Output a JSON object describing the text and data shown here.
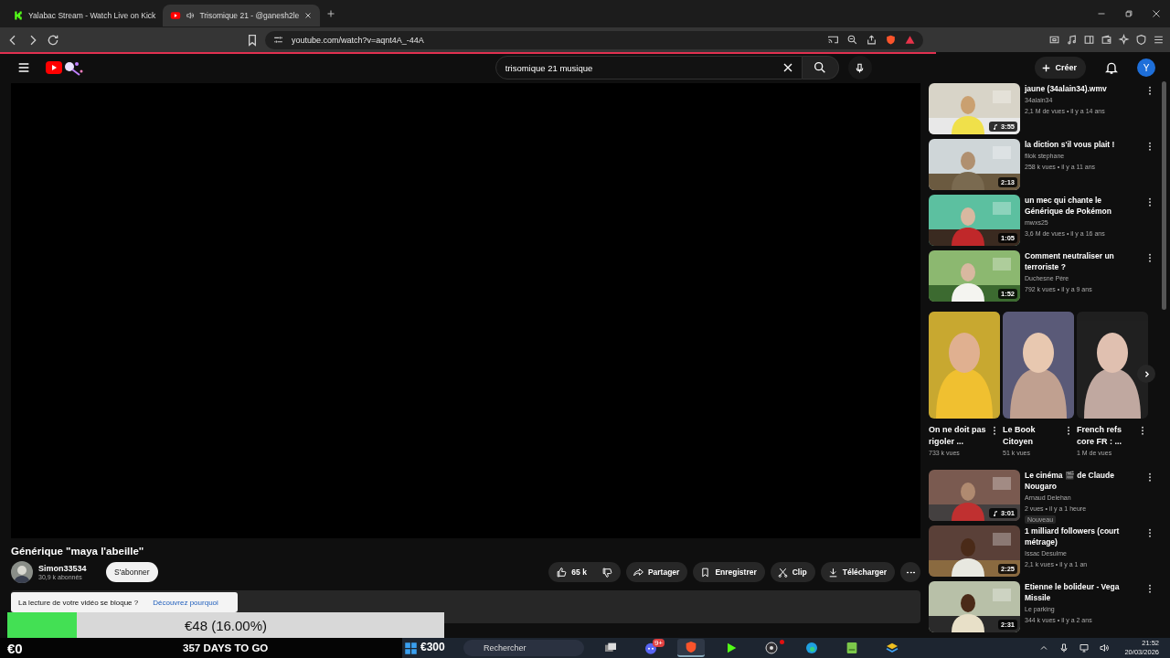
{
  "browser": {
    "tabs": [
      {
        "title": "Yalabac Stream - Watch Live on Kick",
        "kind": "kick",
        "selected": false,
        "audio": false
      },
      {
        "title": "Trisomique 21 - @ganesh2le",
        "kind": "youtube",
        "selected": true,
        "audio": true
      }
    ],
    "url": "youtube.com/watch?v=aqnt4A_-44A"
  },
  "youtube": {
    "search": {
      "value": "trisomique 21 musique"
    },
    "create": "Créer",
    "avatar": "Y",
    "video": {
      "title": "Générique \"maya l'abeille\"",
      "channel": "Simon33534",
      "subscribers": "30,9 k abonnés",
      "subscribe": "S'abonner",
      "likes": "65 k",
      "actions": [
        {
          "kind": "share",
          "label": "Partager"
        },
        {
          "kind": "save",
          "label": "Enregistrer"
        },
        {
          "kind": "clip",
          "label": "Clip"
        },
        {
          "kind": "download",
          "label": "Télécharger"
        }
      ]
    },
    "notice": {
      "text": "La lecture de votre vidéo se bloque ?",
      "link": "Découvrez pourquoi"
    },
    "recommendations_top": [
      {
        "title": "jaune (34alain34).wmv",
        "channel": "34alain34",
        "meta": "2,1 M de vues • il y a 14 ans",
        "duration": "3:55",
        "music": true
      },
      {
        "title": "la diction s'il vous plait !",
        "channel": "filok stephane",
        "meta": "258 k vues • il y a 11 ans",
        "duration": "2:13",
        "music": false
      },
      {
        "title": "un mec qui chante le Générique de Pokémon",
        "channel": "mwxs25",
        "meta": "3,6 M de vues • il y a 16 ans",
        "duration": "1:05",
        "music": false
      },
      {
        "title": "Comment neutraliser un terroriste ?",
        "channel": "Duchesne Père",
        "meta": "792 k vues • il y a 9 ans",
        "duration": "1:52",
        "music": false
      }
    ],
    "shorts": [
      {
        "title": "On ne doit pas rigoler ...",
        "views": "733 k vues"
      },
      {
        "title": "Le Book Citoyen",
        "views": "51 k vues"
      },
      {
        "title": "French refs core FR : ...",
        "views": "1 M de vues"
      }
    ],
    "recommendations_bottom": [
      {
        "title": "Le cinéma 🎬 de Claude Nougaro",
        "channel": "Arnaud Delehan",
        "meta": "2 vues • il y a 1 heure",
        "duration": "3:01",
        "music": true,
        "badge": "Nouveau"
      },
      {
        "title": "1 milliard followers (court métrage)",
        "channel": "Issac Desulme",
        "meta": "2,1 k vues • il y a 1 an",
        "duration": "2:25",
        "music": false
      },
      {
        "title": "Etienne le bolideur - Vega Missile",
        "channel": "Le parking",
        "meta": "344 k vues • il y a 2 ans",
        "duration": "2:31",
        "music": false
      }
    ]
  },
  "overlay": {
    "amount": "€48 (16.00%)",
    "level": 0.16,
    "start": "€0",
    "goal": "€300",
    "days": "357 DAYS TO GO"
  },
  "taskbar": {
    "search_placeholder": "Rechercher",
    "apps": [
      {
        "kind": "taskview",
        "selected": false
      },
      {
        "kind": "discord",
        "badge": "9+",
        "selected": false
      },
      {
        "kind": "brave",
        "selected": true
      },
      {
        "kind": "player",
        "selected": false
      },
      {
        "kind": "obs",
        "selected": false,
        "notification": true
      },
      {
        "kind": "edge",
        "selected": false
      },
      {
        "kind": "notes",
        "selected": false
      },
      {
        "kind": "stack",
        "selected": false
      }
    ],
    "time": "21:52",
    "date": "20/03/2026"
  }
}
